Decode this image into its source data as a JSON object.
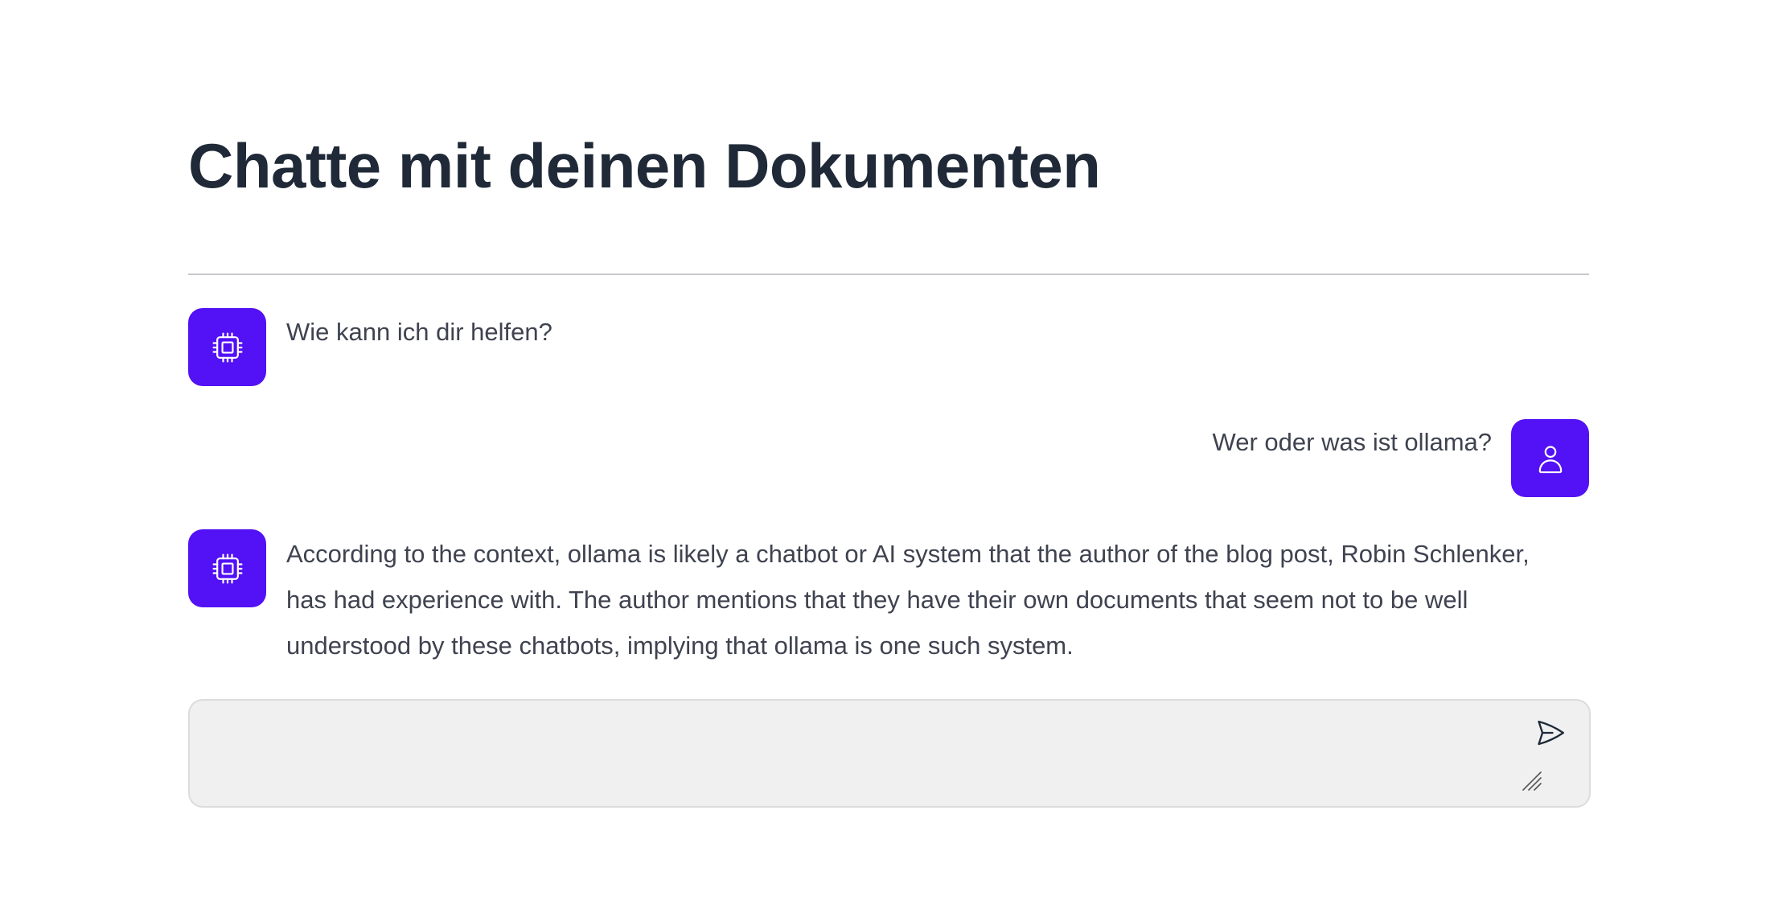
{
  "page": {
    "title": "Chatte mit deinen Dokumenten"
  },
  "messages": [
    {
      "role": "assistant",
      "icon": "cpu-chip-icon",
      "text": "Wie kann ich dir helfen?"
    },
    {
      "role": "user",
      "icon": "user-icon",
      "text": "Wer oder was ist ollama?"
    },
    {
      "role": "assistant",
      "icon": "cpu-chip-icon",
      "text": "According to the context, ollama is likely a chatbot or AI system that the author of the blog post, Robin Schlenker, has had experience with. The author mentions that they have their own documents that seem not to be well understood by these chatbots, implying that ollama is one such system."
    }
  ],
  "composer": {
    "value": "",
    "placeholder": "",
    "send_icon": "paper-airplane-icon"
  },
  "colors": {
    "accent": "#5311f5",
    "title": "#1f2937",
    "text": "#3f4350",
    "composer_bg": "#f0f0f0"
  }
}
